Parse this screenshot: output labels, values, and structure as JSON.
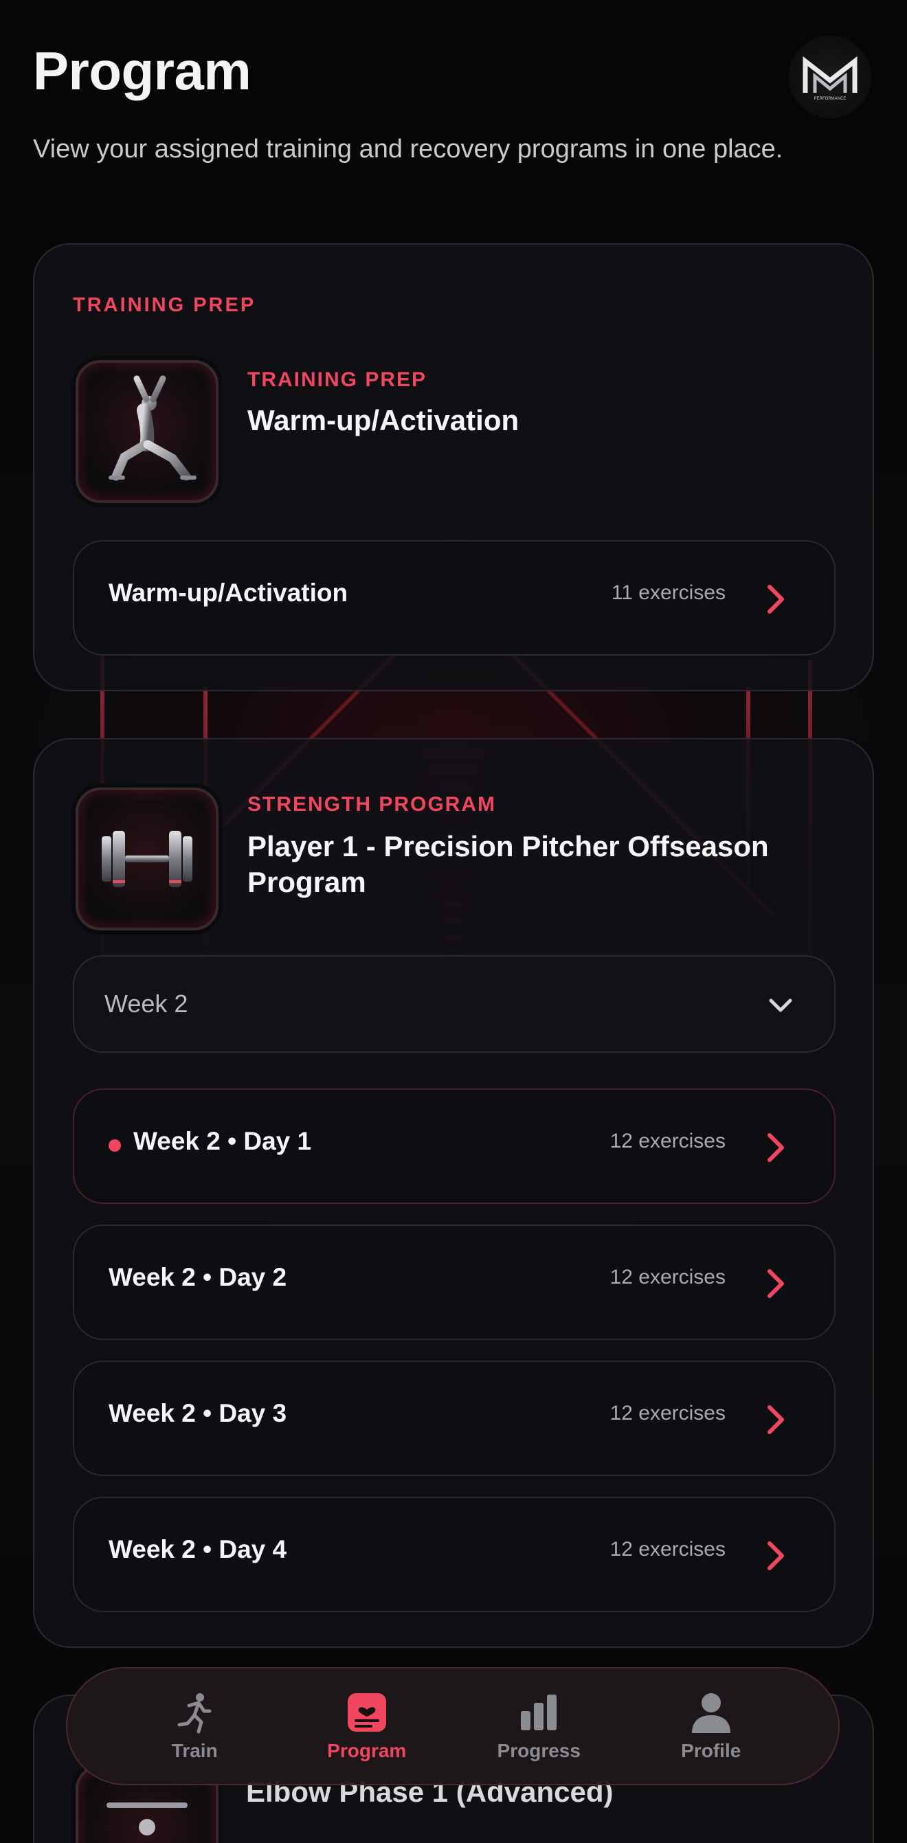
{
  "header": {
    "title": "Program",
    "subtitle": "View your assigned training and recovery programs in one place.",
    "logo_text": "PERFORMANCE"
  },
  "training_prep": {
    "section_label": "TRAINING PREP",
    "kicker": "TRAINING PREP",
    "title": "Warm-up/Activation",
    "thumb_icon": "lunge-athlete-icon",
    "rows": [
      {
        "label": "Warm-up/Activation",
        "count": "11 exercises"
      }
    ]
  },
  "strength": {
    "kicker": "STRENGTH PROGRAM",
    "title_line1": "Player 1 - Precision Pitcher Offseason",
    "title_line2": "Program",
    "thumb_icon": "dumbbell-icon",
    "week_select": {
      "value": "Week 2"
    },
    "days": [
      {
        "label": "Week 2 • Day 1",
        "count": "12 exercises",
        "active": true
      },
      {
        "label": "Week 2 • Day 2",
        "count": "12 exercises"
      },
      {
        "label": "Week 2 • Day 3",
        "count": "12 exercises"
      },
      {
        "label": "Week 2 • Day 4",
        "count": "12 exercises"
      }
    ]
  },
  "peek_card": {
    "title": "Elbow Phase 1 (Advanced)"
  },
  "tabbar": {
    "tabs": [
      {
        "label": "Train",
        "icon": "runner-icon"
      },
      {
        "label": "Program",
        "icon": "program-heart-icon",
        "active": true
      },
      {
        "label": "Progress",
        "icon": "bar-chart-icon"
      },
      {
        "label": "Profile",
        "icon": "person-icon"
      }
    ]
  },
  "colors": {
    "accent": "#f0465f",
    "background": "#050506",
    "card": "#121216",
    "muted_text": "#a9a9b0"
  }
}
